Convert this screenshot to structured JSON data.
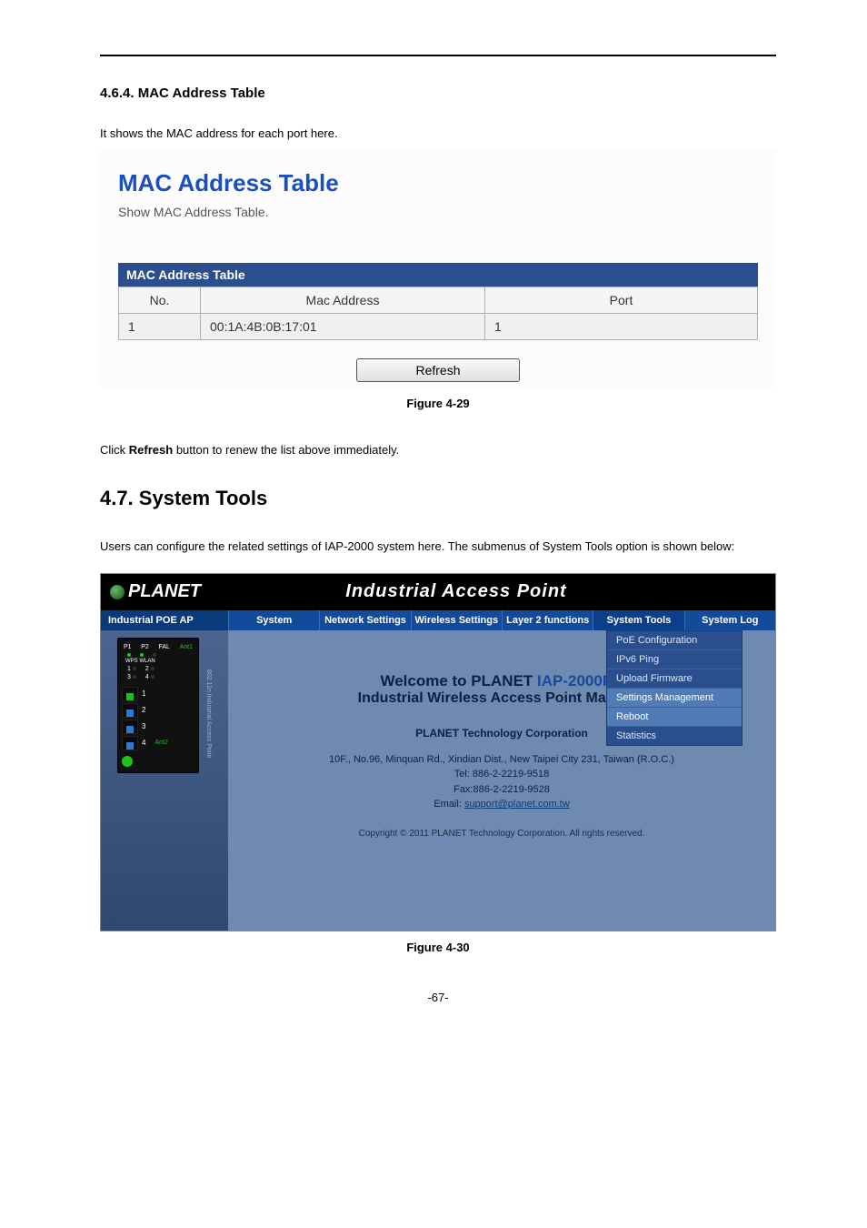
{
  "section_a": {
    "heading": "4.6.4.  MAC Address Table",
    "intro": "It shows the MAC address for each port here.",
    "panel_title": "MAC Address Table",
    "panel_sub": "Show MAC Address Table.",
    "caption": "MAC Address Table",
    "columns": {
      "no": "No.",
      "mac": "Mac Address",
      "port": "Port"
    },
    "rows": [
      {
        "no": "1",
        "mac": "00:1A:4B:0B:17:01",
        "port": "1"
      }
    ],
    "refresh_label": "Refresh",
    "figure": "Figure 4-29",
    "after_fig": "Click Refresh button to renew the list above immediately."
  },
  "after_fig_parts": {
    "p1": "Click ",
    "bold": "Refresh",
    "p2": " button to renew the list above immediately."
  },
  "section_b": {
    "heading": "4.7.  System Tools",
    "intro": "Users can configure the related settings of IAP-2000 system here. The submenus of System Tools option is shown below:"
  },
  "screenshot": {
    "brand": "PLANET",
    "banner": "Industrial Access Point",
    "left_label": "Industrial POE AP",
    "nav": [
      "System",
      "Network Settings",
      "Wireless Settings",
      "Layer 2 functions",
      "System Tools",
      "System Log"
    ],
    "active_nav_index": 4,
    "dropdown": [
      {
        "label": "PoE Configuration",
        "selected": false
      },
      {
        "label": "IPv6 Ping",
        "selected": false
      },
      {
        "label": "Upload Firmware",
        "selected": false
      },
      {
        "label": "Settings Management",
        "selected": true
      },
      {
        "label": "Reboot",
        "selected": true
      },
      {
        "label": "Statistics",
        "selected": false
      }
    ],
    "welcome_prefix": "Welcome to PLANET ",
    "welcome_model": "IAP-2000PS",
    "welcome_sub": "Industrial Wireless Access Point Manager",
    "corp": "PLANET Technology Corporation",
    "addr_line1": "10F., No.96, Minquan Rd., Xindian Dist., New Taipei City 231, Taiwan (R.O.C.)",
    "addr_line2": "Tel: 886-2-2219-9518",
    "addr_line3": "Fax:886-2-2219-9528",
    "addr_email_label": "Email: ",
    "addr_email": "support@planet.com.tw",
    "copyright": "Copyright © 2011 PLANET Technology Corporation. All rights reserved.",
    "device": {
      "labels_top": {
        "p1": "P1",
        "p2": "P2",
        "fal": "FAL",
        "ant1": "Ant1"
      },
      "wps": "WPS WLAN",
      "side": "802.11n Industrial Access Point",
      "ant2": "Ant2",
      "ports": [
        "1",
        "2",
        "3",
        "4"
      ]
    }
  },
  "figure_b": "Figure 4-30",
  "page_number": "-67-"
}
